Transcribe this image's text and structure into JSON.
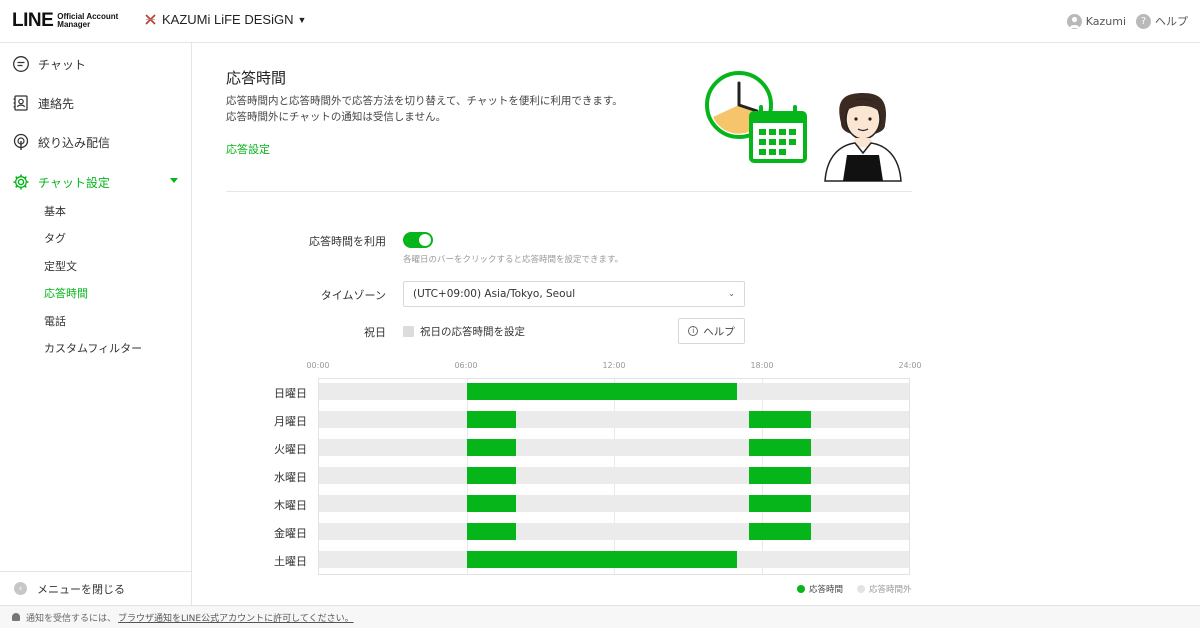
{
  "header": {
    "logo_main": "LINE",
    "logo_sub_1": "Official Account",
    "logo_sub_2": "Manager",
    "account_name": "KAZUMi LiFE DESiGN",
    "user_name": "Kazumi",
    "help_label": "ヘルプ"
  },
  "sidebar": {
    "items": [
      {
        "label": "チャット",
        "icon": "chat-icon"
      },
      {
        "label": "連絡先",
        "icon": "contacts-icon"
      },
      {
        "label": "絞り込み配信",
        "icon": "broadcast-icon"
      },
      {
        "label": "チャット設定",
        "icon": "gear-icon",
        "active": true
      }
    ],
    "sub_items": [
      "基本",
      "タグ",
      "定型文",
      "応答時間",
      "電話",
      "カスタムフィルター"
    ],
    "active_sub": "応答時間",
    "close_menu": "メニューを閉じる"
  },
  "main": {
    "title": "応答時間",
    "desc_line1": "応答時間内と応答時間外で応答方法を切り替えて、チャットを便利に利用できます。",
    "desc_line2": "応答時間外にチャットの通知は受信しません。",
    "setting_link": "応答設定",
    "use_label": "応答時間を利用",
    "use_enabled": true,
    "use_hint": "各曜日のバーをクリックすると応答時間を設定できます。",
    "timezone_label": "タイムゾーン",
    "timezone_value": "(UTC+09:00) Asia/Tokyo, Seoul",
    "holiday_label": "祝日",
    "holiday_checkbox": "祝日の応答時間を設定",
    "help_button": "ヘルプ"
  },
  "schedule": {
    "ticks": [
      "00:00",
      "06:00",
      "12:00",
      "18:00",
      "24:00"
    ],
    "days": [
      {
        "label": "日曜日",
        "ranges": [
          [
            6,
            17
          ]
        ]
      },
      {
        "label": "月曜日",
        "ranges": [
          [
            6,
            8
          ],
          [
            17.5,
            20
          ]
        ]
      },
      {
        "label": "火曜日",
        "ranges": [
          [
            6,
            8
          ],
          [
            17.5,
            20
          ]
        ]
      },
      {
        "label": "水曜日",
        "ranges": [
          [
            6,
            8
          ],
          [
            17.5,
            20
          ]
        ]
      },
      {
        "label": "木曜日",
        "ranges": [
          [
            6,
            8
          ],
          [
            17.5,
            20
          ]
        ]
      },
      {
        "label": "金曜日",
        "ranges": [
          [
            6,
            8
          ],
          [
            17.5,
            20
          ]
        ]
      },
      {
        "label": "土曜日",
        "ranges": [
          [
            6,
            17
          ]
        ]
      }
    ],
    "legend_in": "応答時間",
    "legend_out": "応答時間外",
    "colors": {
      "in": "#06b51a",
      "out": "#ebebeb"
    }
  },
  "notification": {
    "prefix": "通知を受信するには、",
    "link": "ブラウザ通知をLINE公式アカウントに許可してください。"
  }
}
